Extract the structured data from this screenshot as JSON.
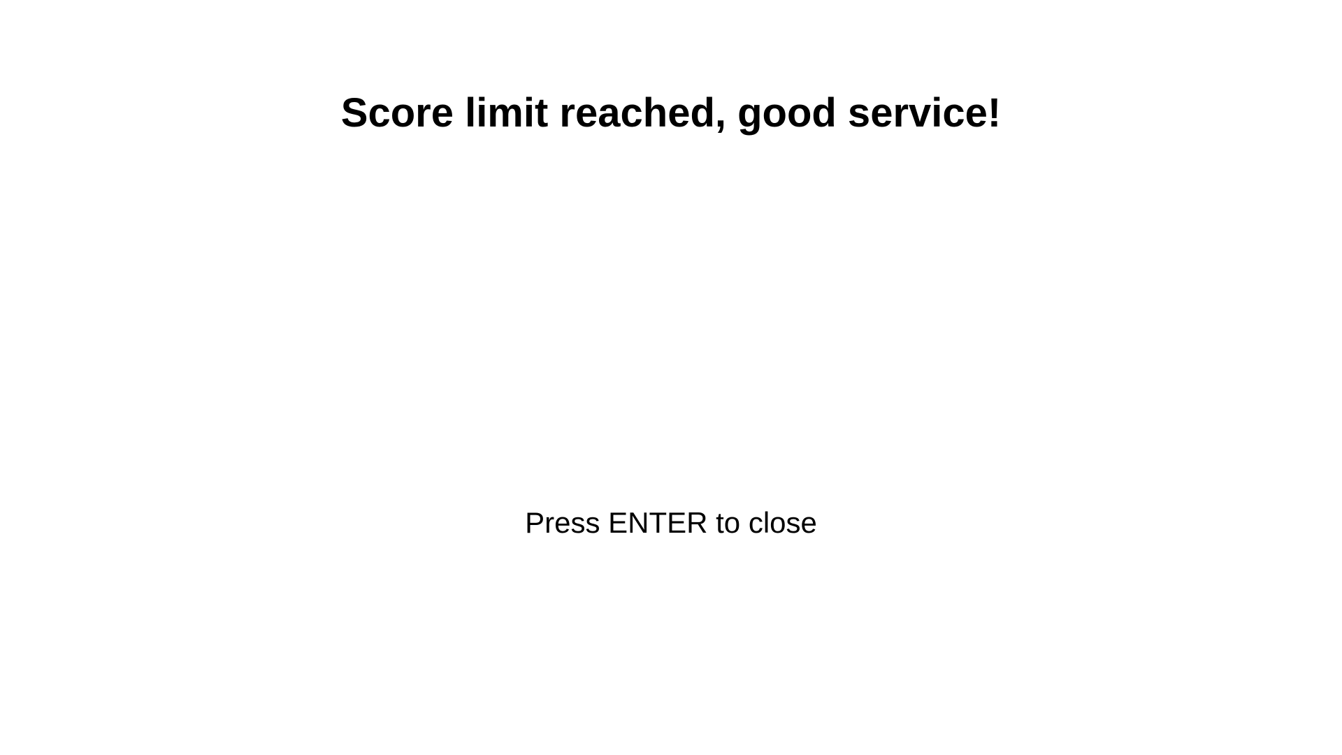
{
  "message": {
    "title": "Score limit reached, good service!",
    "prompt": "Press ENTER to close"
  },
  "colors": {
    "background": "#ffffff",
    "text": "#000000"
  }
}
